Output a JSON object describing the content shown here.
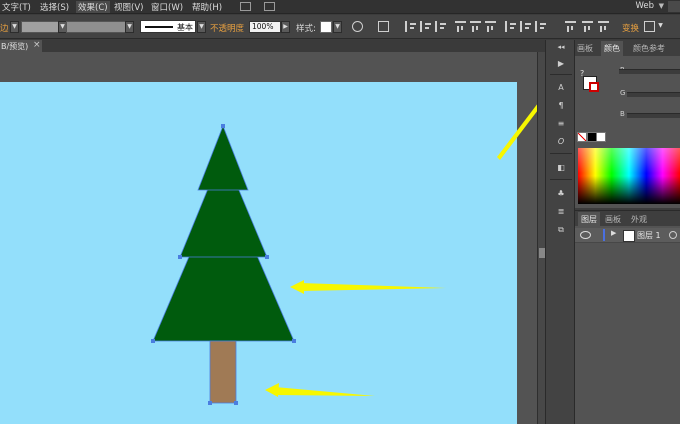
{
  "menu": {
    "items": [
      "文字(T)",
      "选择(S)",
      "效果(C)",
      "视图(V)",
      "窗口(W)",
      "帮助(H)"
    ],
    "workspace": "Web"
  },
  "control_bar": {
    "stroke_label": "边",
    "brush_label": "基本",
    "opacity_label": "不透明度",
    "opacity_value": "100%",
    "style_label": "样式:",
    "transform_label": "变换"
  },
  "document": {
    "tab_title": "B/预览)",
    "close": "×"
  },
  "color_panel": {
    "tabs": [
      "画板",
      "颜色",
      "颜色参考"
    ],
    "channels": [
      "R",
      "G",
      "B"
    ],
    "out_of_gamut": "?"
  },
  "layers_panel": {
    "tabs": [
      "图层",
      "画板",
      "外观"
    ],
    "layer_name": "图层 1"
  },
  "colors": {
    "artboard": "#93dffb",
    "tree": "#005b0d",
    "trunk": "#a07a55",
    "annotation_arrow": "#f7f700",
    "selection": "#4a7ee0"
  }
}
